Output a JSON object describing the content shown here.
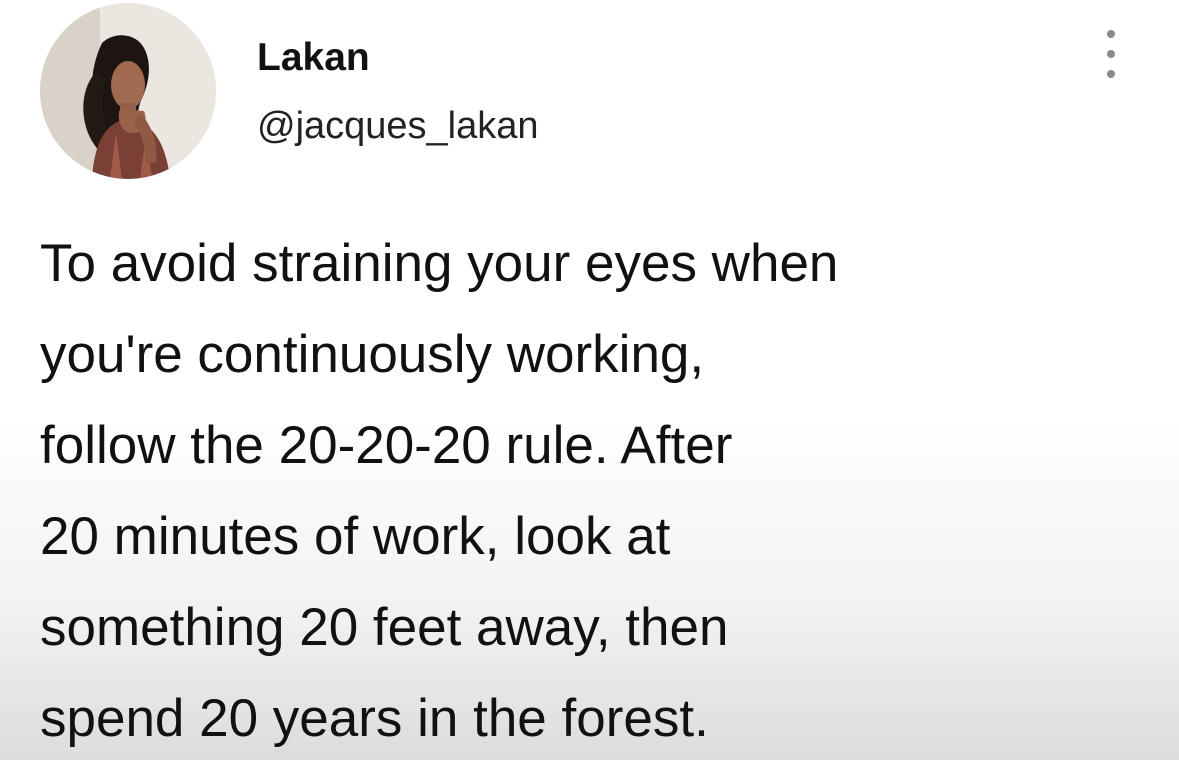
{
  "author": {
    "display_name": "Lakan",
    "handle": "@jacques_lakan",
    "avatar_icon": "profile-photo"
  },
  "tweet": {
    "lines": [
      "To avoid straining your eyes when",
      "you're continuously working,",
      "follow the 20-20-20 rule. After",
      "20 minutes of work, look at",
      "something 20 feet away, then",
      "spend 20 years in the forest."
    ]
  },
  "menu": {
    "icon": "more-options-icon"
  },
  "colors": {
    "text": "#111111",
    "secondary_text": "#222222",
    "menu_dots": "#8a8a8a",
    "background": "#ffffff"
  }
}
